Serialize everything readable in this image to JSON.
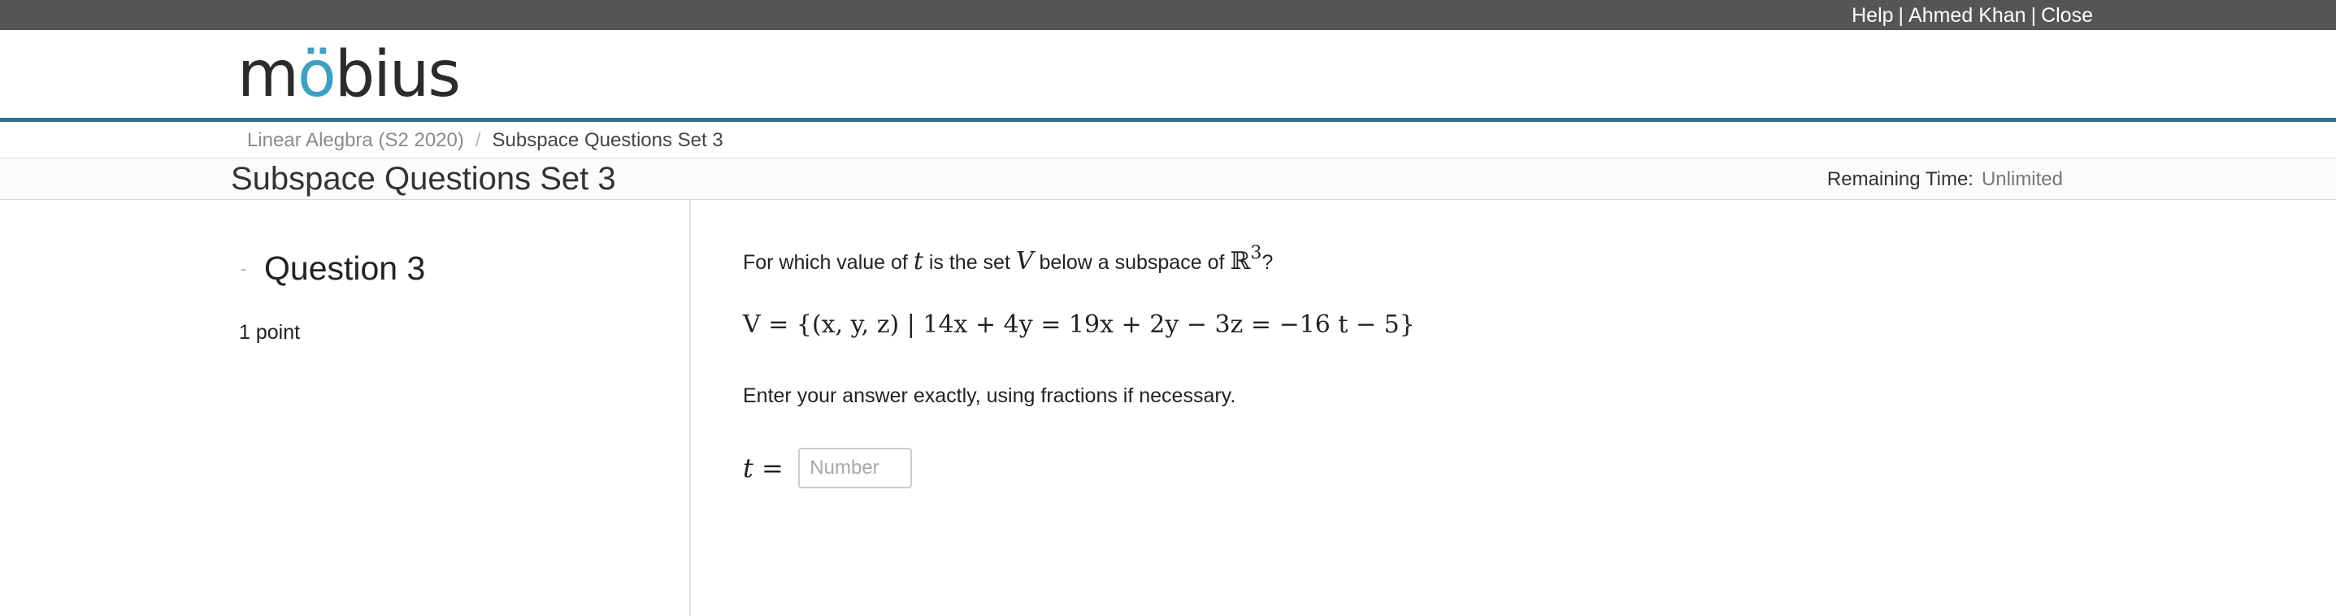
{
  "topbar": {
    "help": "Help",
    "separator": "|",
    "user": "Ahmed Khan",
    "close": "Close"
  },
  "logo": {
    "text_before": "m",
    "text_o": "ö",
    "text_after": "bius"
  },
  "breadcrumb": {
    "course": "Linear Alegbra (S2 2020)",
    "separator": "/",
    "current": "Subspace Questions Set 3"
  },
  "page": {
    "title": "Subspace Questions Set 3",
    "remaining_label": "Remaining Time:",
    "remaining_value": "Unlimited"
  },
  "question": {
    "collapse": "-",
    "title": "Question 3",
    "points": "1 point",
    "prompt_start": "For which value of",
    "prompt_var_t": "t",
    "prompt_mid": "is the set",
    "prompt_var_V": "V",
    "prompt_end": "below a subspace of",
    "prompt_space": "ℝ",
    "prompt_exp": "3",
    "prompt_q": "?",
    "set_definition": "V = {(x, y, z) | 14x + 4y = 19x + 2y − 3z = −16 t − 5}",
    "instructions": "Enter your answer exactly, using fractions if necessary.",
    "answer_label": "t =",
    "answer_placeholder": "Number",
    "answer_value": ""
  }
}
